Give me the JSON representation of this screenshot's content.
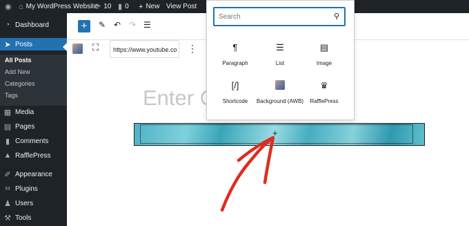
{
  "admin_bar": {
    "site_name": "My WordPress Website",
    "updates_count": "10",
    "comments_count": "0",
    "new_label": "New",
    "view_post_label": "View Post"
  },
  "sidebar": {
    "items": [
      {
        "label": "Dashboard",
        "icon": "dashboard-icon"
      },
      {
        "label": "Posts",
        "icon": "pin-icon"
      },
      {
        "label": "Media",
        "icon": "media-icon"
      },
      {
        "label": "Pages",
        "icon": "pages-icon"
      },
      {
        "label": "Comments",
        "icon": "comments-icon"
      },
      {
        "label": "RafflePress",
        "icon": "rafflepress-icon"
      },
      {
        "label": "Appearance",
        "icon": "appearance-icon"
      },
      {
        "label": "Plugins",
        "icon": "plugins-icon"
      },
      {
        "label": "Users",
        "icon": "users-icon"
      },
      {
        "label": "Tools",
        "icon": "tools-icon"
      }
    ],
    "submenu": [
      "All Posts",
      "Add New",
      "Categories",
      "Tags"
    ]
  },
  "editor": {
    "url_value": "https://www.youtube.co",
    "title_placeholder": "Enter C"
  },
  "inserter": {
    "search_placeholder": "Search",
    "blocks": [
      {
        "label": "Paragraph",
        "icon": "paragraph-icon"
      },
      {
        "label": "List",
        "icon": "list-icon"
      },
      {
        "label": "Image",
        "icon": "image-icon"
      },
      {
        "label": "Shortcode",
        "icon": "shortcode-icon"
      },
      {
        "label": "Background (AWB)",
        "icon": "background-icon"
      },
      {
        "label": "RafflePress",
        "icon": "rafflepress-icon"
      }
    ]
  },
  "colors": {
    "admin_dark": "#1d2327",
    "accent_blue": "#2271b1",
    "annotation_red": "#e02c20"
  }
}
